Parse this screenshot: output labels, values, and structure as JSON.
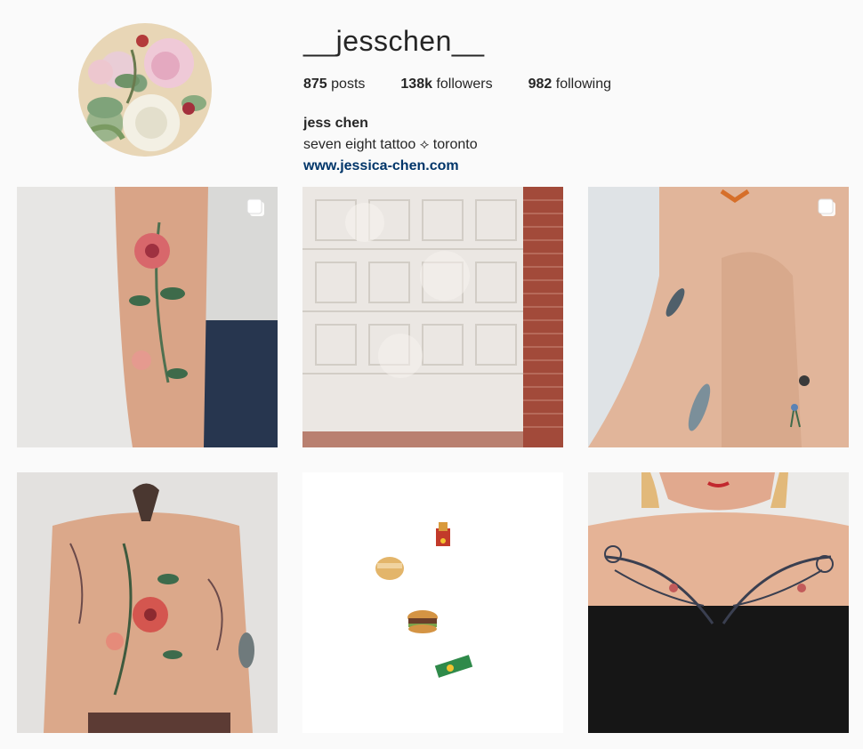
{
  "profile": {
    "username": "__jesschen__",
    "posts_count": "875",
    "posts_label": "posts",
    "followers_count": "138k",
    "followers_label": "followers",
    "following_count": "982",
    "following_label": "following",
    "full_name": "jess chen",
    "bio": "seven eight tattoo ⟡ toronto",
    "website": "www.jessica-chen.com"
  },
  "posts": [
    {
      "subject": "floral arm tattoo",
      "multi": true
    },
    {
      "subject": "garage door with brick wall",
      "multi": false
    },
    {
      "subject": "small arm tattoos",
      "multi": true
    },
    {
      "subject": "floral back tattoo",
      "multi": false
    },
    {
      "subject": "fast food tattoos",
      "multi": false
    },
    {
      "subject": "chest line tattoo",
      "multi": false
    }
  ],
  "colors": {
    "link": "#003569",
    "background": "#fafafa",
    "text": "#262626"
  }
}
